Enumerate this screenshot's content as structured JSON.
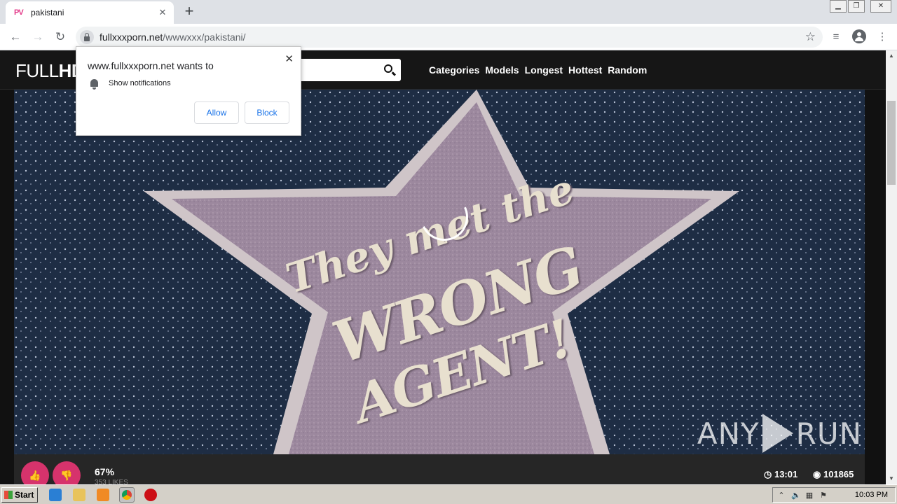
{
  "browser": {
    "tab_title": "pakistani",
    "tab_favicon": "PV",
    "url_host": "fullxxxporn.net",
    "url_path": "/wwwxxx/pakistani/"
  },
  "popup": {
    "title": "www.fullxxxporn.net wants to",
    "permission": "Show notifications",
    "allow_label": "Allow",
    "block_label": "Block"
  },
  "site": {
    "logo_light": "FULL",
    "logo_bold": "HD",
    "nav": [
      "Categories",
      "Models",
      "Longest",
      "Hottest",
      "Random"
    ]
  },
  "video": {
    "overlay_line1": "They met the",
    "overlay_line2": "WRONG",
    "overlay_line3": "AGENT!",
    "watermark_left": "ANY",
    "watermark_right": "RUN"
  },
  "infobar": {
    "rating": "67%",
    "likes": "353 LIKES",
    "duration": "13:01",
    "views": "101865"
  },
  "taskbar": {
    "start_label": "Start",
    "clock": "10:03 PM"
  },
  "colors": {
    "accent": "#d6336c",
    "chrome_tabstrip": "#dee1e6",
    "site_bg": "#111111"
  }
}
